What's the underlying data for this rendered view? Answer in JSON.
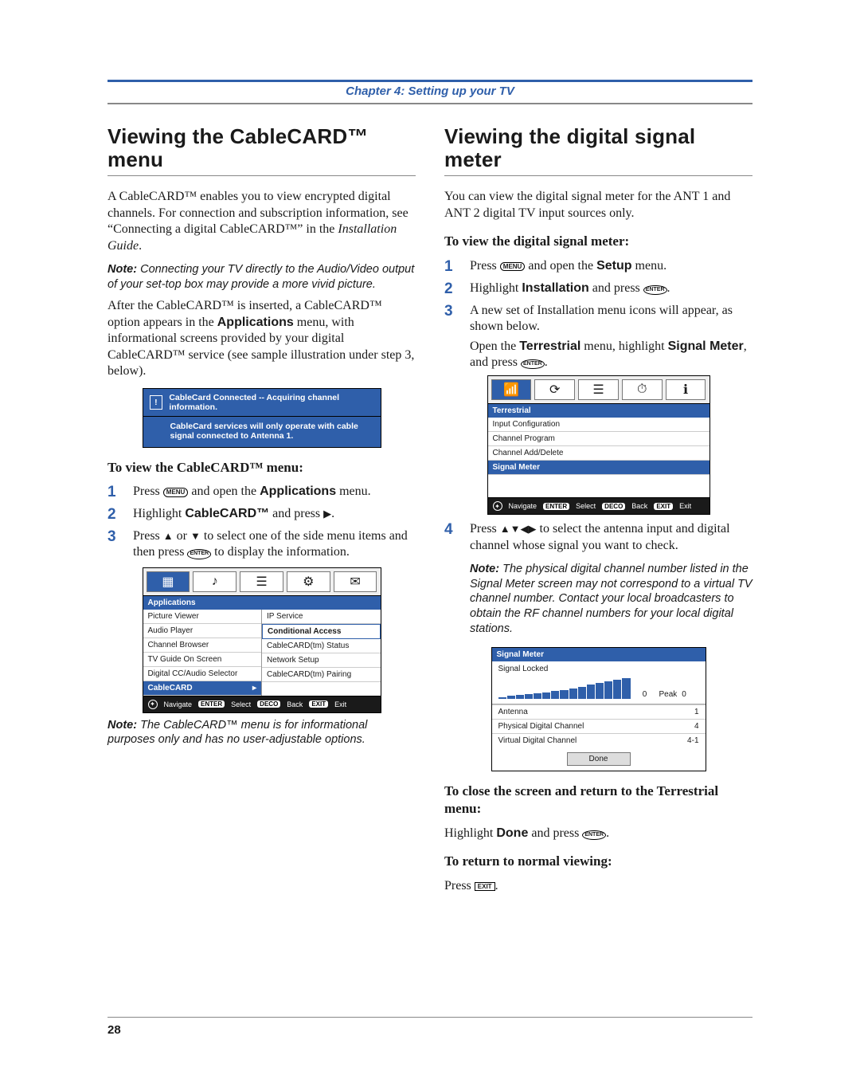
{
  "chapter": "Chapter 4: Setting up your TV",
  "page_number": "28",
  "left": {
    "heading": "Viewing the CableCARD™ menu",
    "p1a": "A CableCARD™ enables you to view encrypted digital channels. For connection and subscription information, see “Connecting a digital CableCARD™” in the ",
    "p1b": "Installation Guide",
    "p1c": ".",
    "note1_lead": "Note:",
    "note1": " Connecting your TV directly to the Audio/Video output of your set-top box may provide a more vivid picture.",
    "p2a": "After the CableCARD™ is inserted, a CableCARD™ option appears in the ",
    "p2b": "Applications",
    "p2c": " menu, with informational screens provided by your digital CableCARD™ service (see sample illustration under step 3, below).",
    "blue_box": {
      "line1": "CableCard Connected -- Acquiring channel information.",
      "line2": "CableCard services will only operate with cable signal connected to Antenna 1."
    },
    "sub_h": "To view the CableCARD™ menu:",
    "step1a": "Press ",
    "menu_btn": "MENU",
    "step1b": " and open the ",
    "step1c": "Applications",
    "step1d": " menu.",
    "step2a": "Highlight ",
    "step2b": "CableCARD™",
    "step2c": " and press ",
    "right_tri": "▶",
    "step2d": ".",
    "step3a": "Press ",
    "up_tri": "▲",
    "or": " or ",
    "down_tri": "▼",
    "step3b": " to select one of the side menu items and then press ",
    "enter_btn": "ENTER",
    "step3c": " to display the information.",
    "apps_menu": {
      "category": "Applications",
      "left_items": [
        "Picture Viewer",
        "Audio Player",
        "Channel Browser",
        "TV Guide On Screen",
        "Digital CC/Audio Selector",
        "CableCARD"
      ],
      "right_items": [
        "IP Service",
        "Conditional Access",
        "CableCARD(tm) Status",
        "Network Setup",
        "CableCARD(tm) Pairing"
      ]
    },
    "footbar": {
      "nav": "Navigate",
      "sel": "Select",
      "back": "Back",
      "exit": "Exit",
      "k_enter": "ENTER",
      "k_deco": "DECO",
      "k_exit": "EXIT"
    },
    "note2_lead": "Note:",
    "note2": " The CableCARD™ menu is for informational purposes only and has no user-adjustable options."
  },
  "right": {
    "heading": "Viewing the digital signal meter",
    "p1": "You can view the digital signal meter for the ANT 1 and ANT 2 digital TV input sources only.",
    "sub_h1": "To view the digital signal meter:",
    "s1a": "Press ",
    "menu_btn": "MENU",
    "s1b": " and open the ",
    "s1c": "Setup",
    "s1d": " menu.",
    "s2a": "Highlight ",
    "s2b": "Installation",
    "s2c": " and press ",
    "enter_btn": "ENTER",
    "s2d": ".",
    "s3a": "A new set of Installation menu icons will appear, as shown below.",
    "s3b": "Open the ",
    "s3c": "Terrestrial",
    "s3d": " menu, highlight ",
    "s3e": "Signal Meter",
    "s3f": ", and press ",
    "s3g": ".",
    "terr_menu": {
      "category": "Terrestrial",
      "items": [
        "Input Configuration",
        "Channel Program",
        "Channel Add/Delete",
        "Signal Meter"
      ]
    },
    "footbar": {
      "nav": "Navigate",
      "sel": "Select",
      "back": "Back",
      "exit": "Exit",
      "k_enter": "ENTER",
      "k_deco": "DECO",
      "k_exit": "EXIT"
    },
    "s4a": "Press ",
    "up": "▲",
    "down": "▼",
    "left": "◀",
    "rightt": "▶",
    "s4b": " to select the antenna input and digital channel whose signal you want to check.",
    "note_lead": "Note:",
    "note": " The physical digital channel number listed in the Signal Meter screen may not correspond to a virtual TV channel number. Contact your local broadcasters to obtain the RF channel numbers for your local digital stations.",
    "sig": {
      "title": "Signal Meter",
      "locked": "Signal Locked",
      "cur": "0",
      "peak_lbl": "Peak",
      "peak": "0",
      "rows": [
        {
          "l": "Antenna",
          "v": "1"
        },
        {
          "l": "Physical Digital Channel",
          "v": "4"
        },
        {
          "l": "Virtual Digital Channel",
          "v": "4-1"
        }
      ],
      "done": "Done"
    },
    "sub_h2": "To close the screen and return to the Terrestrial menu:",
    "close_a": "Highlight ",
    "close_b": "Done",
    "close_c": " and press ",
    "close_d": ".",
    "sub_h3": "To return to normal viewing:",
    "ret_a": "Press ",
    "exit_btn": "EXIT",
    "ret_b": "."
  }
}
